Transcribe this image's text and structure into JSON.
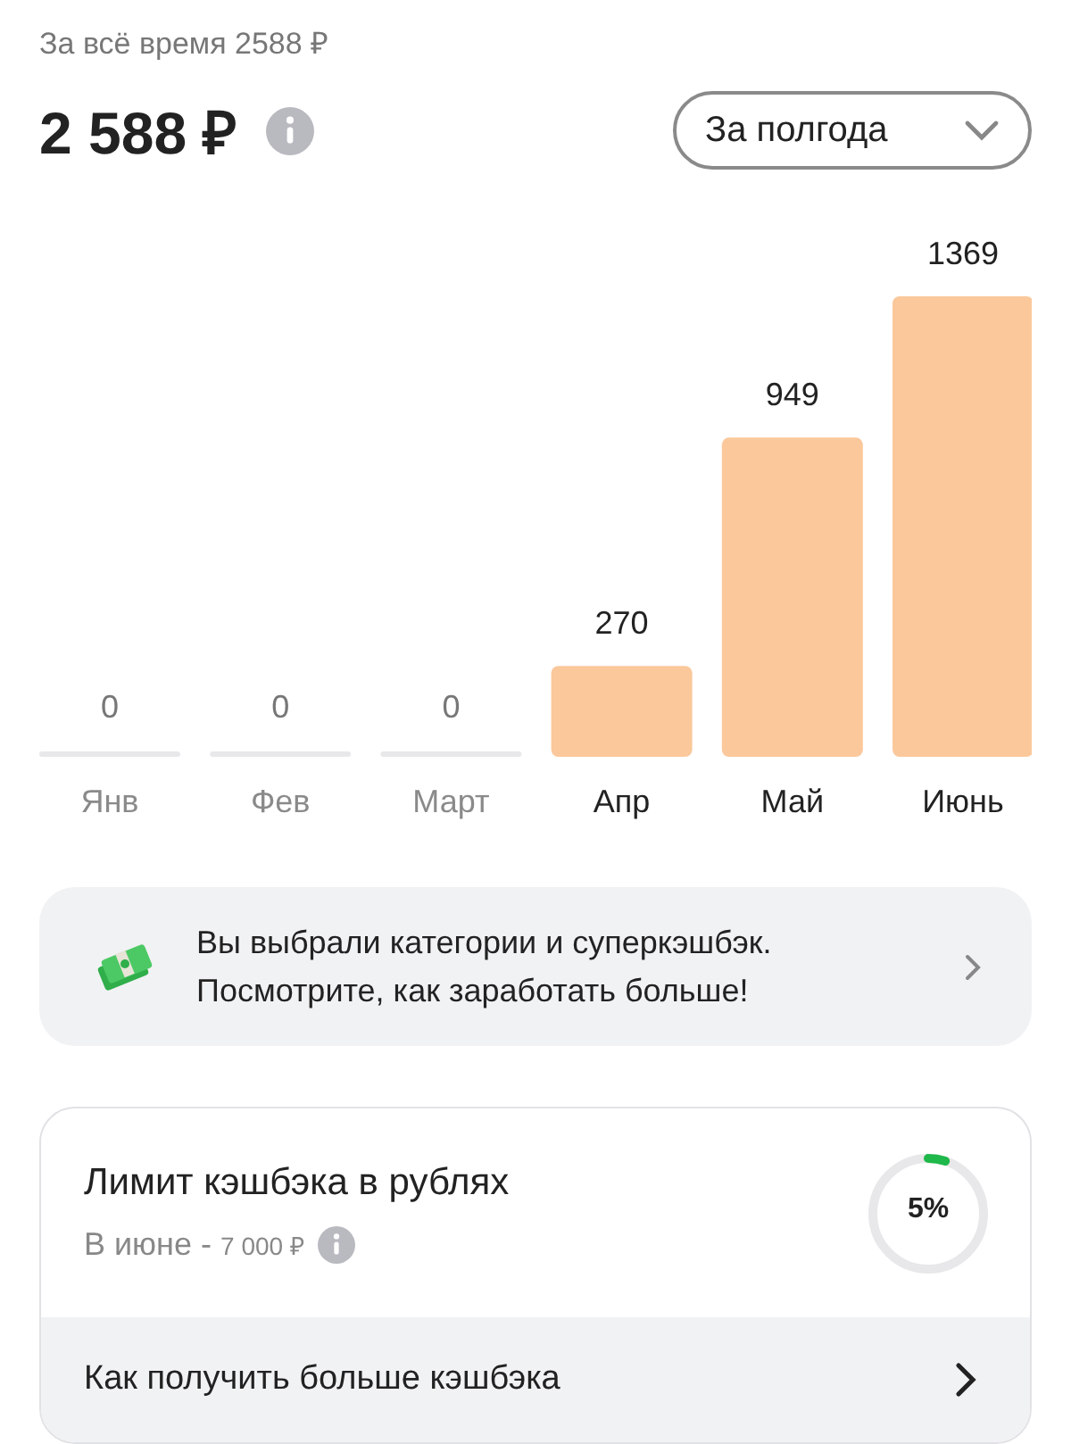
{
  "total_all_time": "За всё время 2588 ₽",
  "total": "2 588 ₽",
  "period_dropdown": {
    "value": "За полгода"
  },
  "chart": {
    "chart_data": {
      "type": "bar",
      "categories": [
        "Янв",
        "Фев",
        "Март",
        "Апр",
        "Май",
        "Июнь"
      ],
      "series": [
        {
          "color": "#fbc89b",
          "values": [
            0,
            0,
            0,
            270,
            949,
            1369
          ]
        }
      ],
      "data_labels": true
    }
  },
  "banner": {
    "text": "Вы выбрали категории и суперкэшбэк. Посмотрите, как заработать больше!"
  },
  "limit": {
    "title": "Лимит кэшбэка в рублях",
    "period": "В июне -",
    "amount": "7 000 ₽",
    "percent": "5%",
    "link": "Как получить больше кэшбэка"
  }
}
